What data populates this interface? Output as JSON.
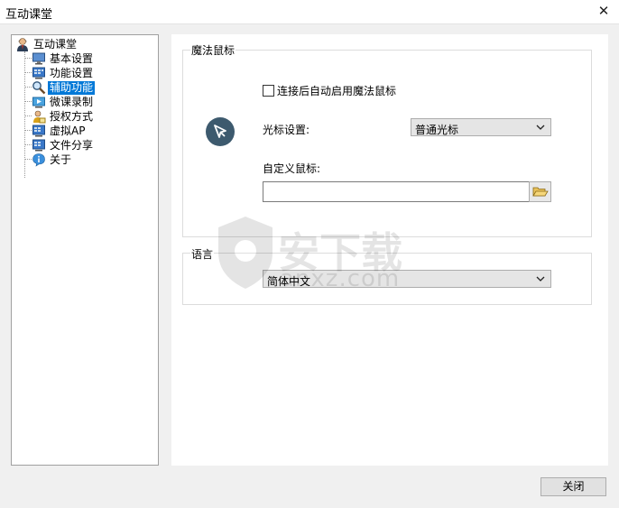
{
  "window": {
    "title": "互动课堂"
  },
  "tree": {
    "root_label": "互动课堂",
    "items": [
      {
        "label": "基本设置",
        "selected": false
      },
      {
        "label": "功能设置",
        "selected": false
      },
      {
        "label": "辅助功能",
        "selected": true
      },
      {
        "label": "微课录制",
        "selected": false
      },
      {
        "label": "授权方式",
        "selected": false
      },
      {
        "label": "虚拟AP",
        "selected": false
      },
      {
        "label": "文件分享",
        "selected": false
      },
      {
        "label": "关于",
        "selected": false
      }
    ]
  },
  "magic_mouse": {
    "group_title": "魔法鼠标",
    "auto_enable_label": "连接后自动启用魔法鼠标",
    "auto_enable_checked": false,
    "cursor_setting_label": "光标设置:",
    "cursor_setting_value": "普通光标",
    "custom_cursor_label": "自定义鼠标:",
    "custom_cursor_value": ""
  },
  "language": {
    "group_title": "语言",
    "value": "简体中文"
  },
  "watermark": {
    "text": "安下载",
    "sub": "anxz.com"
  },
  "footer": {
    "close_label": "关闭"
  },
  "colors": {
    "selection": "#0078d7",
    "cursor_badge": "#3d5a6e"
  }
}
